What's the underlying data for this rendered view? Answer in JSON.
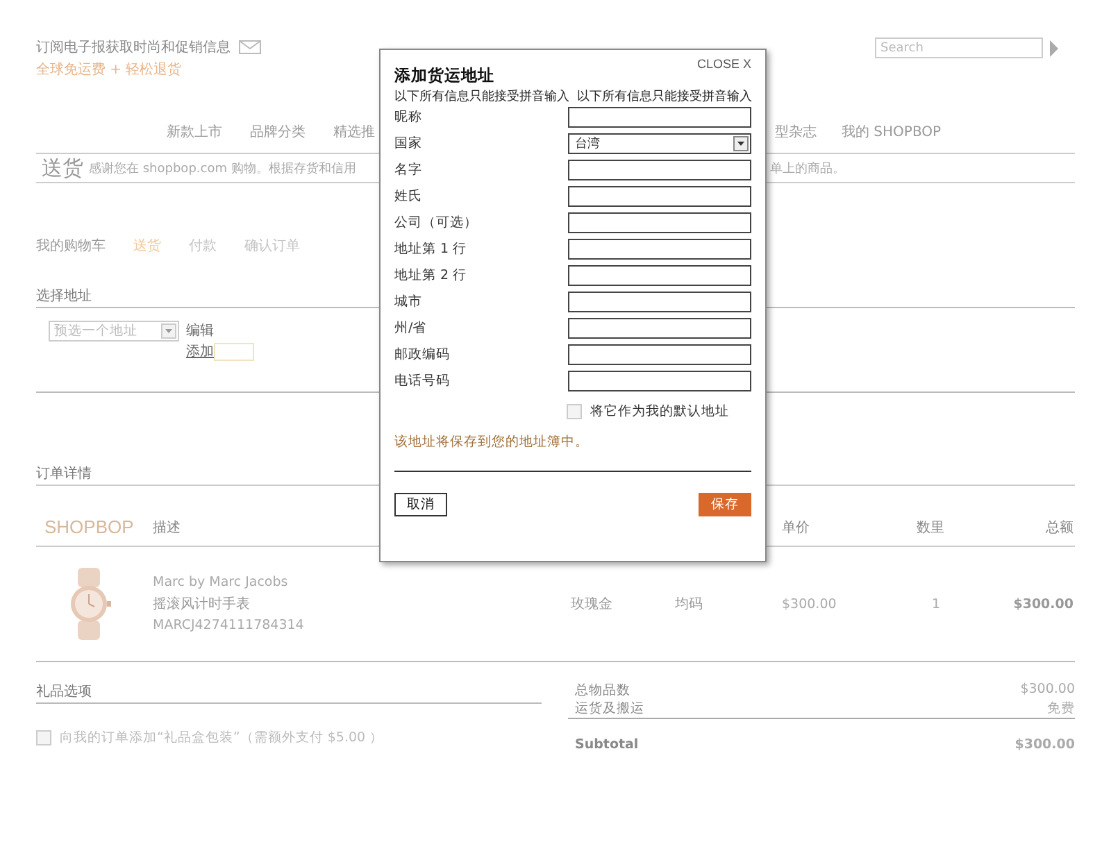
{
  "header": {
    "newsletter": "订阅电子报获取时尚和促销信息",
    "promo": "全球免运费 + 轻松退货",
    "search": {
      "placeholder": "Search"
    }
  },
  "nav_left": [
    {
      "label": "新款上市"
    },
    {
      "label": "品牌分类"
    },
    {
      "label": "精选推"
    }
  ],
  "nav_right": [
    {
      "label": "型杂志"
    },
    {
      "label": "我的 SHOPBOP"
    }
  ],
  "shipping": {
    "title": "送货",
    "note_left": "感谢您在 shopbop.com 购物。根据存货和信用",
    "note_right": "单上的商品。"
  },
  "steps": [
    {
      "label": "我的购物车",
      "selected": false,
      "completed": true
    },
    {
      "label": "送货",
      "selected": true,
      "completed": false
    },
    {
      "label": "付款",
      "selected": false,
      "completed": false
    },
    {
      "label": "确认订单",
      "selected": false,
      "completed": false
    }
  ],
  "address": {
    "title": "选择地址",
    "select": {
      "placeholder": "预选一个地址"
    },
    "edit": "编辑",
    "add": "添加"
  },
  "order": {
    "title": "订单详情",
    "logo": "SHOPBOP",
    "columns": {
      "description": "描述",
      "price": "单价",
      "qty": "数里",
      "total": "总额"
    },
    "items": [
      {
        "brand": "Marc by Marc Jacobs",
        "name": "摇滚风计时手表",
        "sku": "MARCJ4274111784314",
        "finish": "玫瑰金",
        "size": "均码",
        "price": "$300.00",
        "qty": "1",
        "total": "$300.00"
      }
    ]
  },
  "gift": {
    "title": "礼品选项",
    "option": {
      "label": "向我的订单添加“礼品盒包装”（需额外支付 $5.00 ）",
      "checked": false
    }
  },
  "summary": [
    {
      "label": "总物品数",
      "value": "$300.00",
      "kind": "line"
    },
    {
      "label": "运货及搬运",
      "value": "免费",
      "kind": "line"
    },
    {
      "label": "Subtotal",
      "value": "$300.00",
      "kind": "total"
    }
  ],
  "modal": {
    "title": "添加货运地址",
    "close": "CLOSE X",
    "subtitle": "以下所有信息只能接受拼音输入  以下所有信息只能接受拼音输入",
    "fields": [
      {
        "label": "昵称",
        "kind": "text"
      },
      {
        "label": "国家",
        "kind": "select",
        "value": "台湾"
      },
      {
        "label": "名字",
        "kind": "text"
      },
      {
        "label": "姓氏",
        "kind": "text"
      },
      {
        "label": "公司（可选）",
        "kind": "text"
      },
      {
        "label": "地址第 1 行",
        "kind": "text"
      },
      {
        "label": "地址第 2 行",
        "kind": "text"
      },
      {
        "label": "城市",
        "kind": "text"
      },
      {
        "label": "州/省",
        "kind": "text"
      },
      {
        "label": "邮政编码",
        "kind": "text"
      },
      {
        "label": "电话号码",
        "kind": "text"
      }
    ],
    "default_checkbox": {
      "label": "将它作为我的默认地址",
      "checked": false
    },
    "note": "该地址将保存到您的地址簿中。",
    "cancel": "取消",
    "save": "保存"
  }
}
